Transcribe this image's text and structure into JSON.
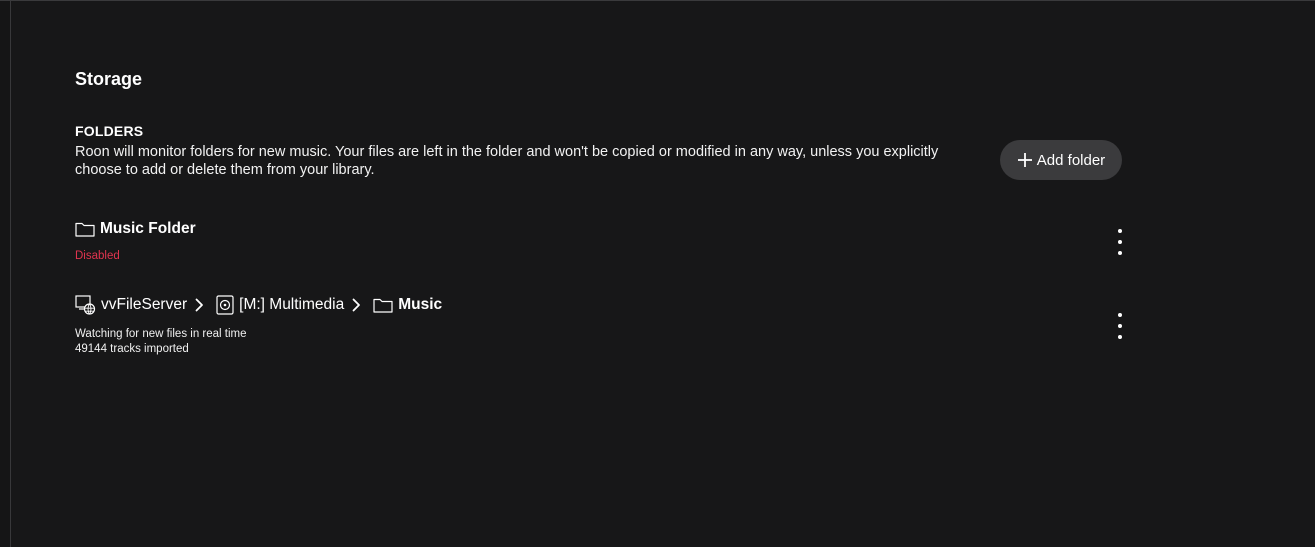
{
  "page": {
    "title": "Storage"
  },
  "folders_section": {
    "title": "FOLDERS",
    "description": "Roon will monitor folders for new music. Your files are left in the folder and won't be copied or modified in any way, unless you explicitly choose to add or delete them from your library.",
    "add_button": {
      "label": "Add folder",
      "icon": "plus-icon"
    }
  },
  "folders": [
    {
      "path": [
        {
          "icon": "folder-icon",
          "label": "Music Folder"
        }
      ],
      "status": "Disabled",
      "status_color": "#e0344f",
      "menu_icon": "more-vertical-icon"
    },
    {
      "path": [
        {
          "icon": "network-server-icon",
          "label": "vvFileServer"
        },
        {
          "icon": "drive-icon",
          "label": "[M:] Multimedia"
        },
        {
          "icon": "folder-icon",
          "label": "Music"
        }
      ],
      "watch_status": "Watching for new files in real time",
      "tracks_imported": "49144 tracks imported",
      "menu_icon": "more-vertical-icon"
    }
  ],
  "colors": {
    "background": "#171718",
    "button_bg": "#3b3b3d",
    "disabled_red": "#e0344f"
  }
}
